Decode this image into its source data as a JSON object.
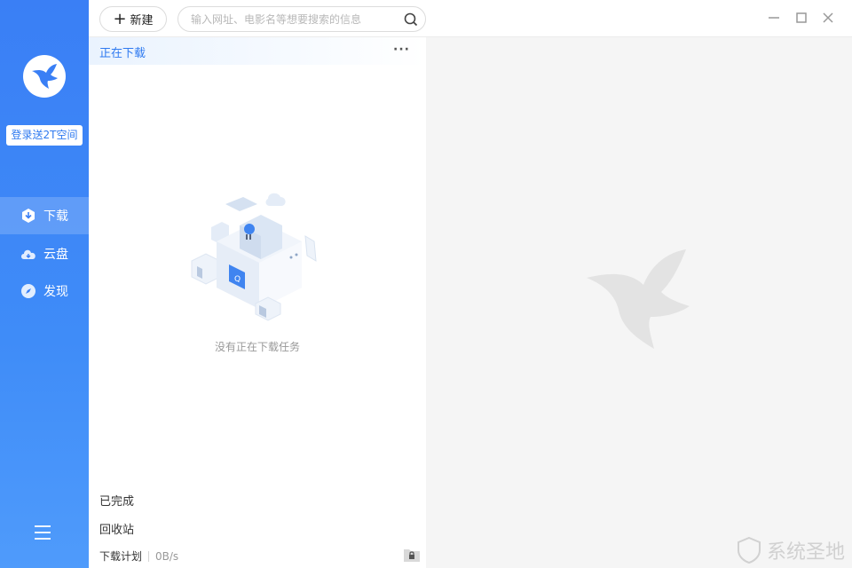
{
  "sidebar": {
    "login_label": "登录送2T空间",
    "nav": [
      {
        "label": "下载",
        "icon": "download-icon"
      },
      {
        "label": "云盘",
        "icon": "cloud-icon"
      },
      {
        "label": "发现",
        "icon": "compass-icon"
      }
    ],
    "menu_icon": "hamburger-icon"
  },
  "toolbar": {
    "new_label": "新建",
    "search_placeholder": "输入网址、电影名等想要搜索的信息"
  },
  "panel": {
    "title": "正在下载",
    "more": "···",
    "empty_message": "没有正在下载任务",
    "completed": "已完成",
    "recycle": "回收站",
    "schedule": "下载计划",
    "speed": "0B/s"
  },
  "watermark": "系统圣地",
  "colors": {
    "accent": "#3a7ff5",
    "title": "#2f7af0"
  }
}
